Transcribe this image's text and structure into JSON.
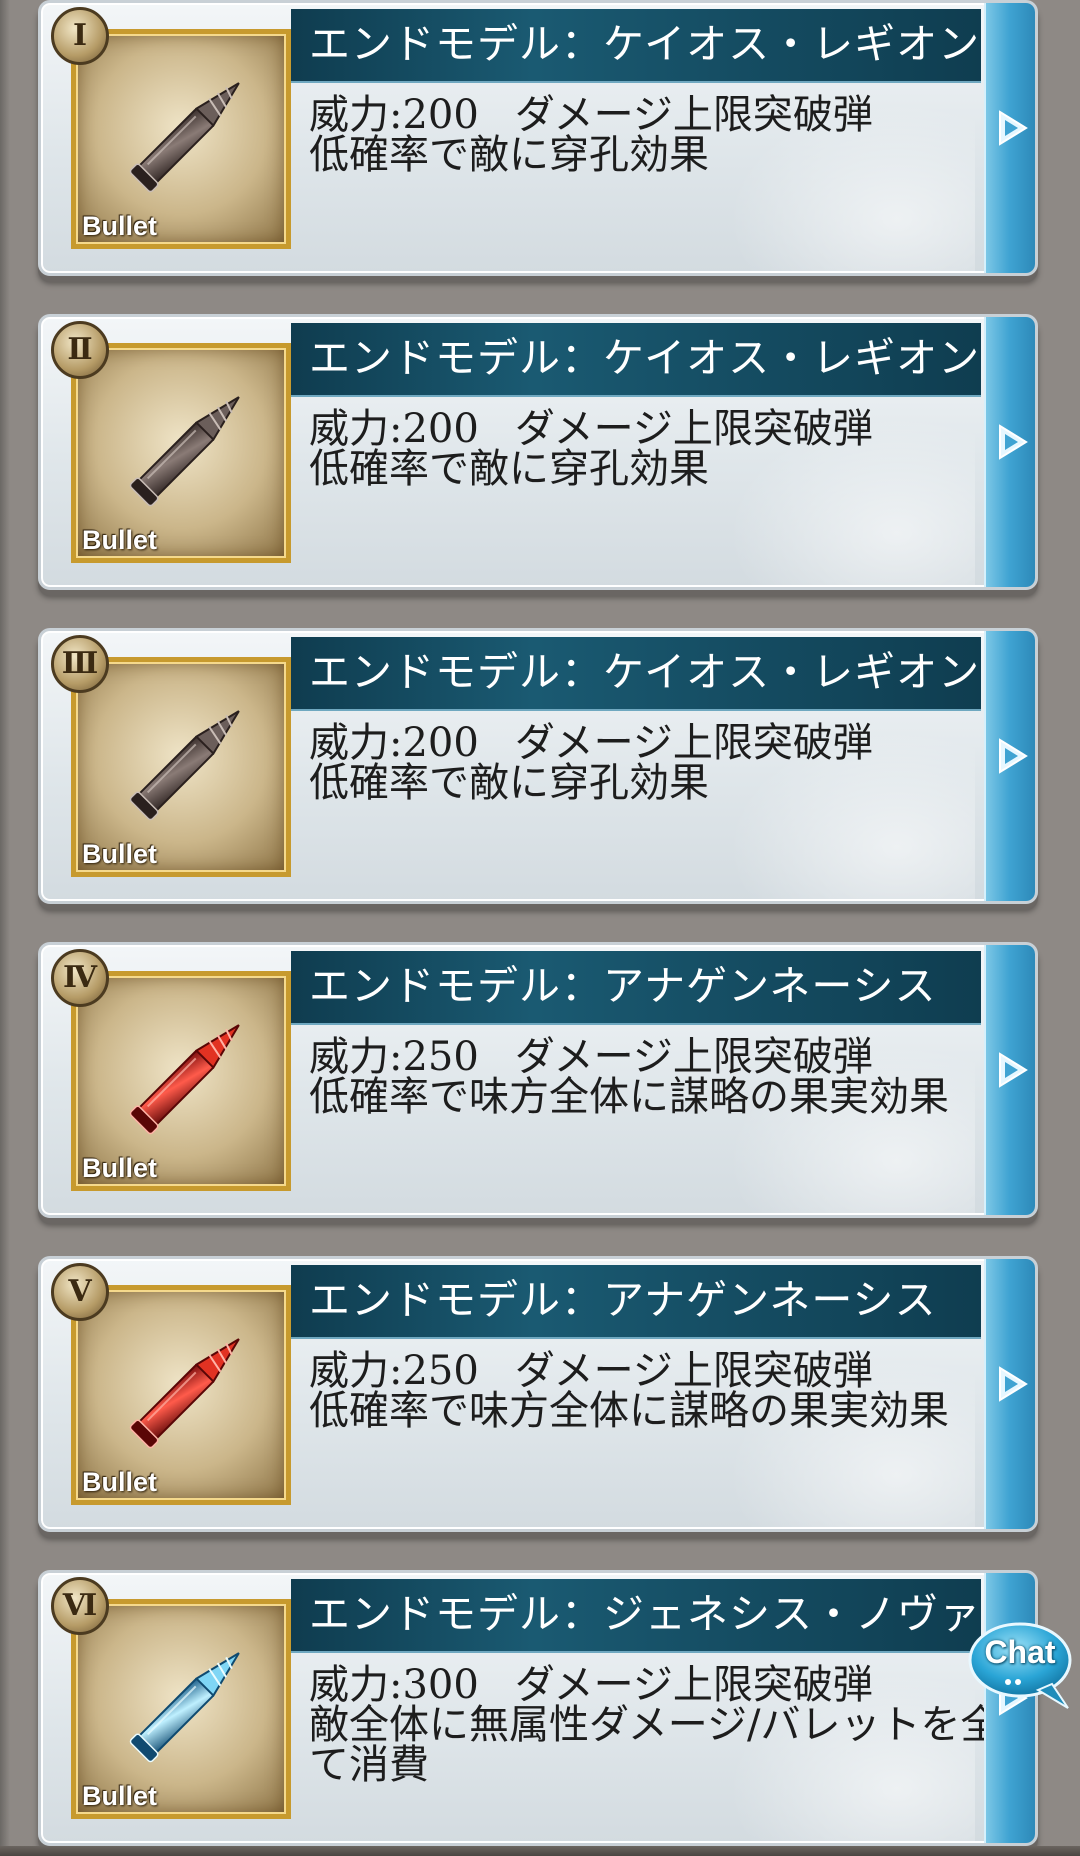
{
  "colors": {
    "title_bar": "#0f3c4f",
    "card_bg": "#e3e9ed",
    "arrow_tab": "#3fa3d2",
    "frame_gold": "#c79a2e",
    "page_bg": "#8e8985"
  },
  "skills": [
    {
      "numeral": "Ⅰ",
      "title": "エンドモデル：ケイオス・レギオン",
      "power": "威力:200",
      "effect": "ダメージ上限突破弾",
      "detail": "低確率で敵に穿孔効果",
      "icon": "dark-bullet-icon",
      "icon_label": "Bullet",
      "bullet_color": "dark"
    },
    {
      "numeral": "Ⅱ",
      "title": "エンドモデル：ケイオス・レギオン",
      "power": "威力:200",
      "effect": "ダメージ上限突破弾",
      "detail": "低確率で敵に穿孔効果",
      "icon": "dark-bullet-icon",
      "icon_label": "Bullet",
      "bullet_color": "dark"
    },
    {
      "numeral": "Ⅲ",
      "title": "エンドモデル：ケイオス・レギオン",
      "power": "威力:200",
      "effect": "ダメージ上限突破弾",
      "detail": "低確率で敵に穿孔効果",
      "icon": "dark-bullet-icon",
      "icon_label": "Bullet",
      "bullet_color": "dark"
    },
    {
      "numeral": "Ⅳ",
      "title": "エンドモデル：アナゲンネーシス",
      "power": "威力:250",
      "effect": "ダメージ上限突破弾",
      "detail": "低確率で味方全体に謀略の果実効果",
      "icon": "red-bullet-icon",
      "icon_label": "Bullet",
      "bullet_color": "red"
    },
    {
      "numeral": "Ⅴ",
      "title": "エンドモデル：アナゲンネーシス",
      "power": "威力:250",
      "effect": "ダメージ上限突破弾",
      "detail": "低確率で味方全体に謀略の果実効果",
      "icon": "red-bullet-icon",
      "icon_label": "Bullet",
      "bullet_color": "red"
    },
    {
      "numeral": "Ⅵ",
      "title": "エンドモデル：ジェネシス・ノヴァ",
      "power": "威力:300",
      "effect": "ダメージ上限突破弾",
      "detail": "敵全体に無属性ダメージ/バレットを全て消費",
      "icon": "blue-bullet-icon",
      "icon_label": "Bullet",
      "bullet_color": "blue"
    }
  ],
  "chat": {
    "label": "Chat",
    "icon": "chat-bubble-icon"
  }
}
